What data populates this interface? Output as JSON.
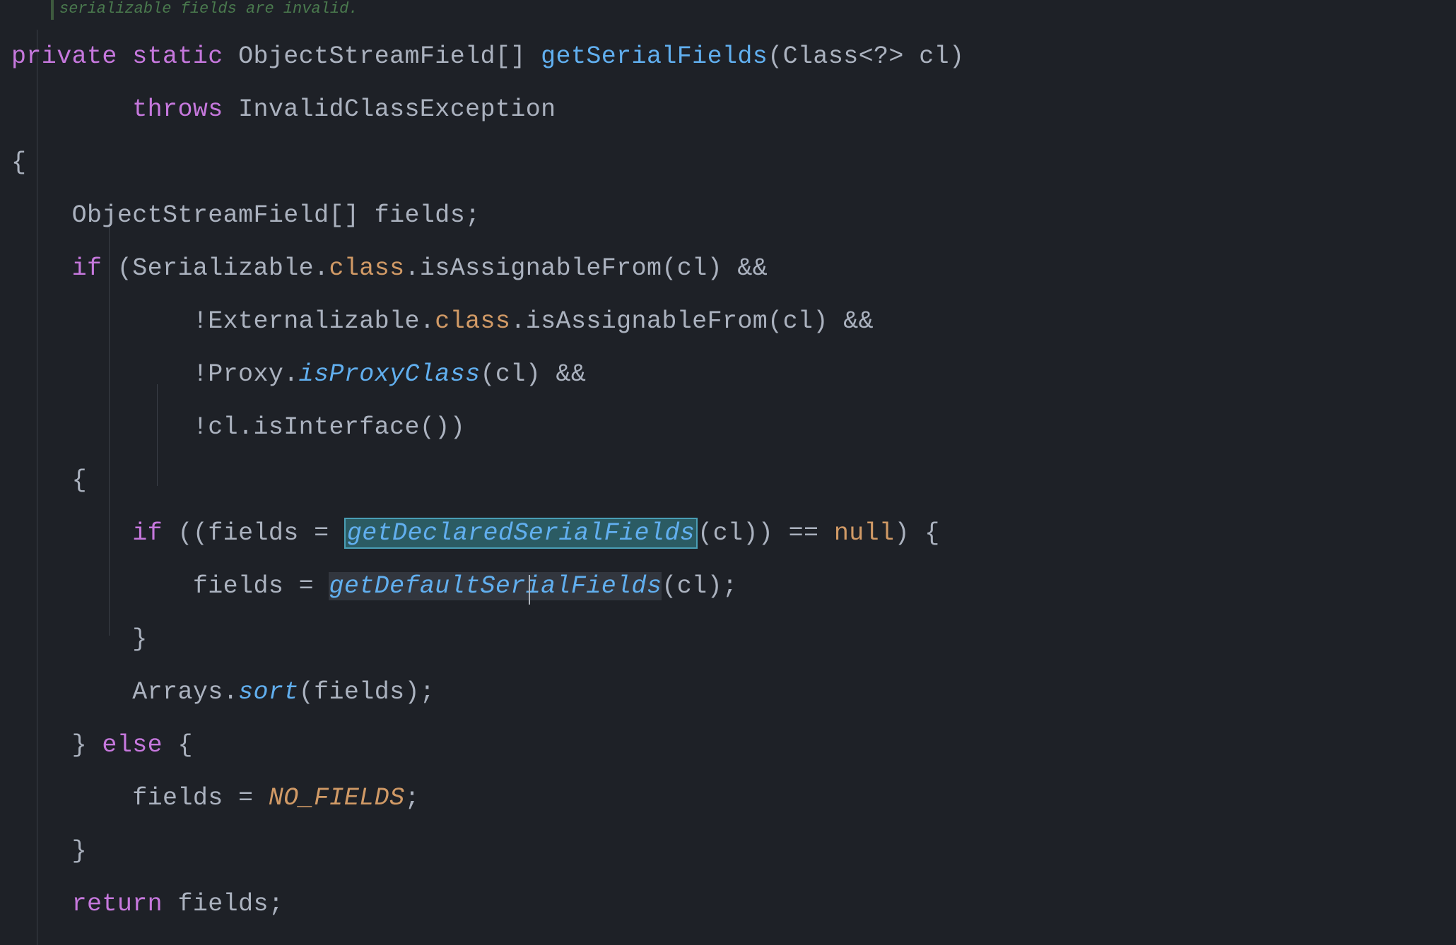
{
  "doc_tail": "serializable fields are invalid.",
  "code": {
    "l1": {
      "kw1": "private",
      "kw2": "static",
      "type": "ObjectStreamField[]",
      "fn": "getSerialFields",
      "sig": "(Class<?> cl)"
    },
    "l2": {
      "kw": "throws",
      "exc": "InvalidClassException"
    },
    "l3": "{",
    "l4": "    ObjectStreamField[] fields;",
    "l5": {
      "kw": "if",
      "pre": " (Serializable.",
      "cls": "class",
      "post": ".isAssignableFrom(cl) &&"
    },
    "l6": {
      "pre": "            !Externalizable.",
      "cls": "class",
      "post": ".isAssignableFrom(cl) &&"
    },
    "l7": {
      "pre": "            !Proxy.",
      "fn": "isProxyClass",
      "post": "(cl) &&"
    },
    "l8": "            !cl.isInterface())",
    "l9": "    {",
    "l10": {
      "kw": "if",
      "pre": " ((fields = ",
      "sel": "getDeclaredSerialFields",
      "mid": "(cl)) == ",
      "nul": "null",
      "post": ") {"
    },
    "l11": {
      "pre": "            fields = ",
      "fn": "getDefaultSerialFields",
      "post": "(cl);"
    },
    "l12": "        }",
    "l13": {
      "pre": "        Arrays.",
      "fn": "sort",
      "post": "(fields);"
    },
    "l14": {
      "pre": "    } ",
      "kw": "else",
      "post": " {"
    },
    "l15": {
      "pre": "        fields = ",
      "const": "NO_FIELDS",
      "post": ";"
    },
    "l16": "    }",
    "l17": {
      "kw": "return",
      "post": " fields;"
    }
  }
}
